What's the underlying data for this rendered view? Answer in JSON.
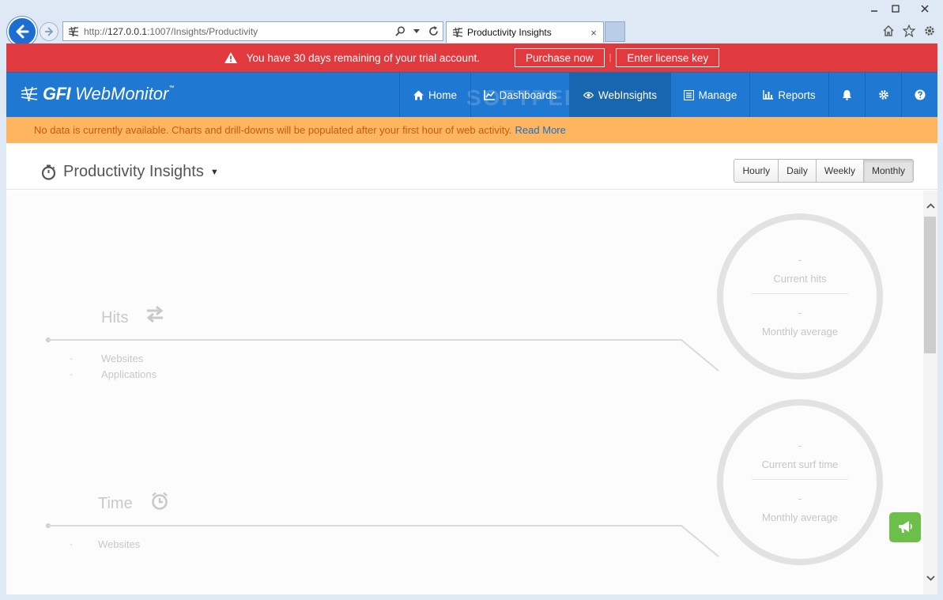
{
  "browser": {
    "url_base": "http://",
    "url_host": "127.0.0.1",
    "url_rest": ":1007/Insights/Productivity",
    "tab_title": "Productivity Insights",
    "tab_close": "×"
  },
  "trial_banner": {
    "message": "You have 30 days remaining of your trial account.",
    "purchase_label": "Purchase now",
    "separator": "|",
    "license_label": "Enter license key"
  },
  "app": {
    "logo_bold": "GFI",
    "logo_rest": "WebMonitor",
    "logo_tm": "™",
    "watermark": "SOFTPEDIA",
    "menu": {
      "home": "Home",
      "dashboards": "Dashboards",
      "webinsights": "WebInsights",
      "manage": "Manage",
      "reports": "Reports"
    }
  },
  "notice": {
    "text": "No data is currently available. Charts and drill-downs will be populated after your first hour of web activity.",
    "link": "Read More"
  },
  "page": {
    "title": "Productivity Insights",
    "caret": "▼",
    "ranges": [
      "Hourly",
      "Daily",
      "Weekly",
      "Monthly"
    ],
    "selected_range": "Monthly"
  },
  "hits": {
    "title": "Hits",
    "rows": [
      {
        "dash": "-",
        "label": "Websites"
      },
      {
        "dash": "-",
        "label": "Applications"
      }
    ],
    "current_value": "-",
    "current_label": "Current hits",
    "avg_value": "-",
    "avg_label": "Monthly average"
  },
  "time": {
    "title": "Time",
    "rows": [
      {
        "dash": "-",
        "label": "Websites"
      }
    ],
    "current_value": "-",
    "current_label": "Current surf time",
    "avg_value": "-",
    "avg_label": "Monthly average"
  },
  "colors": {
    "trial_bg": "#e03a3e",
    "appbar_bg": "#1f78d1",
    "notice_bg": "#fdb55f",
    "fab_bg": "#6cc04a"
  }
}
